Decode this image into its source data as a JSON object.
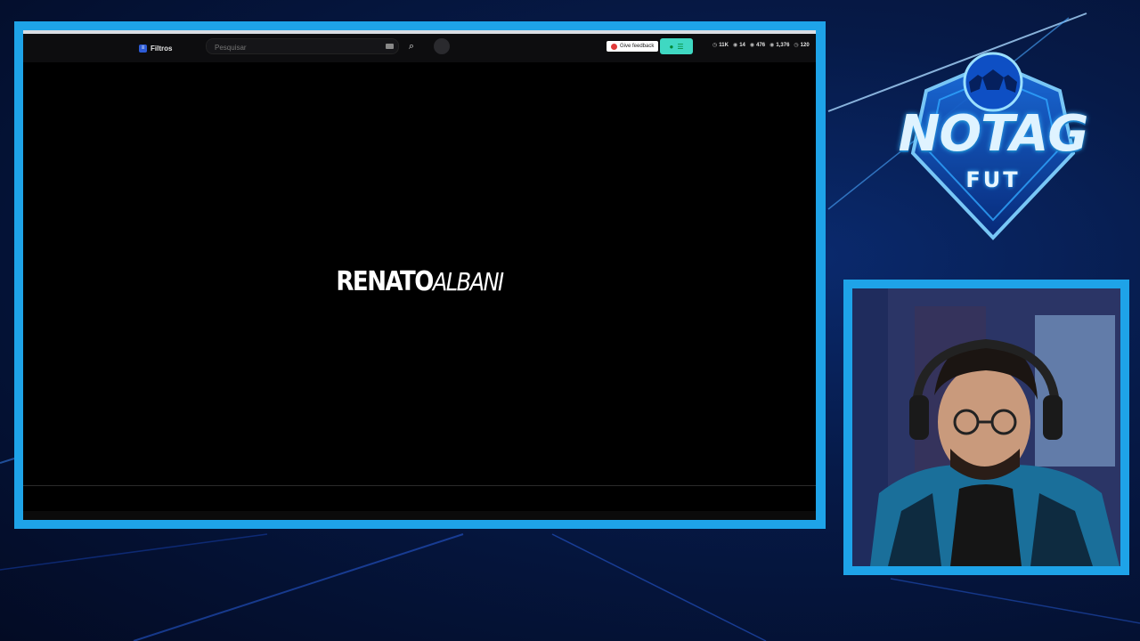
{
  "toolbar": {
    "filters_label": "Filtros",
    "search_placeholder": "Pesquisar",
    "feedback_label": "Give feedback",
    "stats": [
      {
        "icon": "clock-icon",
        "value": "11K"
      },
      {
        "icon": "eye-icon",
        "value": "14"
      },
      {
        "icon": "eye-icon",
        "value": "476"
      },
      {
        "icon": "eye-icon",
        "value": "1,376"
      },
      {
        "icon": "clock-icon",
        "value": "120"
      }
    ]
  },
  "video": {
    "brand_first": "RENATO",
    "brand_second": "ALBANI"
  },
  "overlay": {
    "logo_title": "NOTAG",
    "logo_subtitle": "FUT"
  },
  "colors": {
    "frame": "#1ea3e8",
    "chat_button": "#3fd8c2",
    "background": "#061a48"
  }
}
